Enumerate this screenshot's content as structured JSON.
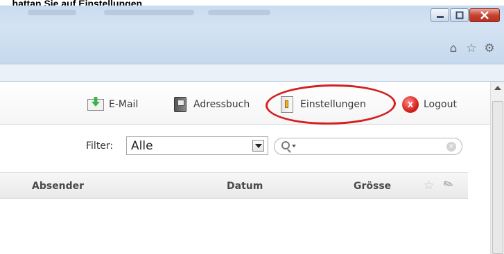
{
  "caption": "... hattan Sie auf Einstellungen",
  "browser": {
    "window_controls": {
      "minimize": "minimize-icon",
      "maximize": "maximize-icon",
      "close": "close-icon"
    },
    "toolbar_icons": [
      "home-icon",
      "star-icon",
      "gear-icon"
    ],
    "toolbar_glyphs": {
      "home": "⌂",
      "star": "☆",
      "gear": "⚙"
    }
  },
  "app_toolbar": {
    "email": "E-Mail",
    "addressbook": "Adressbuch",
    "settings": "Einstellungen",
    "logout": "Logout",
    "logout_glyph": "x"
  },
  "filter": {
    "label": "Filter:",
    "selected": "Alle",
    "search_value": ""
  },
  "table": {
    "columns": [
      "Absender",
      "Datum",
      "Grösse"
    ],
    "flag_icon_glyph": "☆",
    "attachment_icon_glyph": "✎"
  },
  "colors": {
    "highlight_ring": "#d42020",
    "close_button": "#c8432f",
    "chrome": "#c9dcef"
  }
}
